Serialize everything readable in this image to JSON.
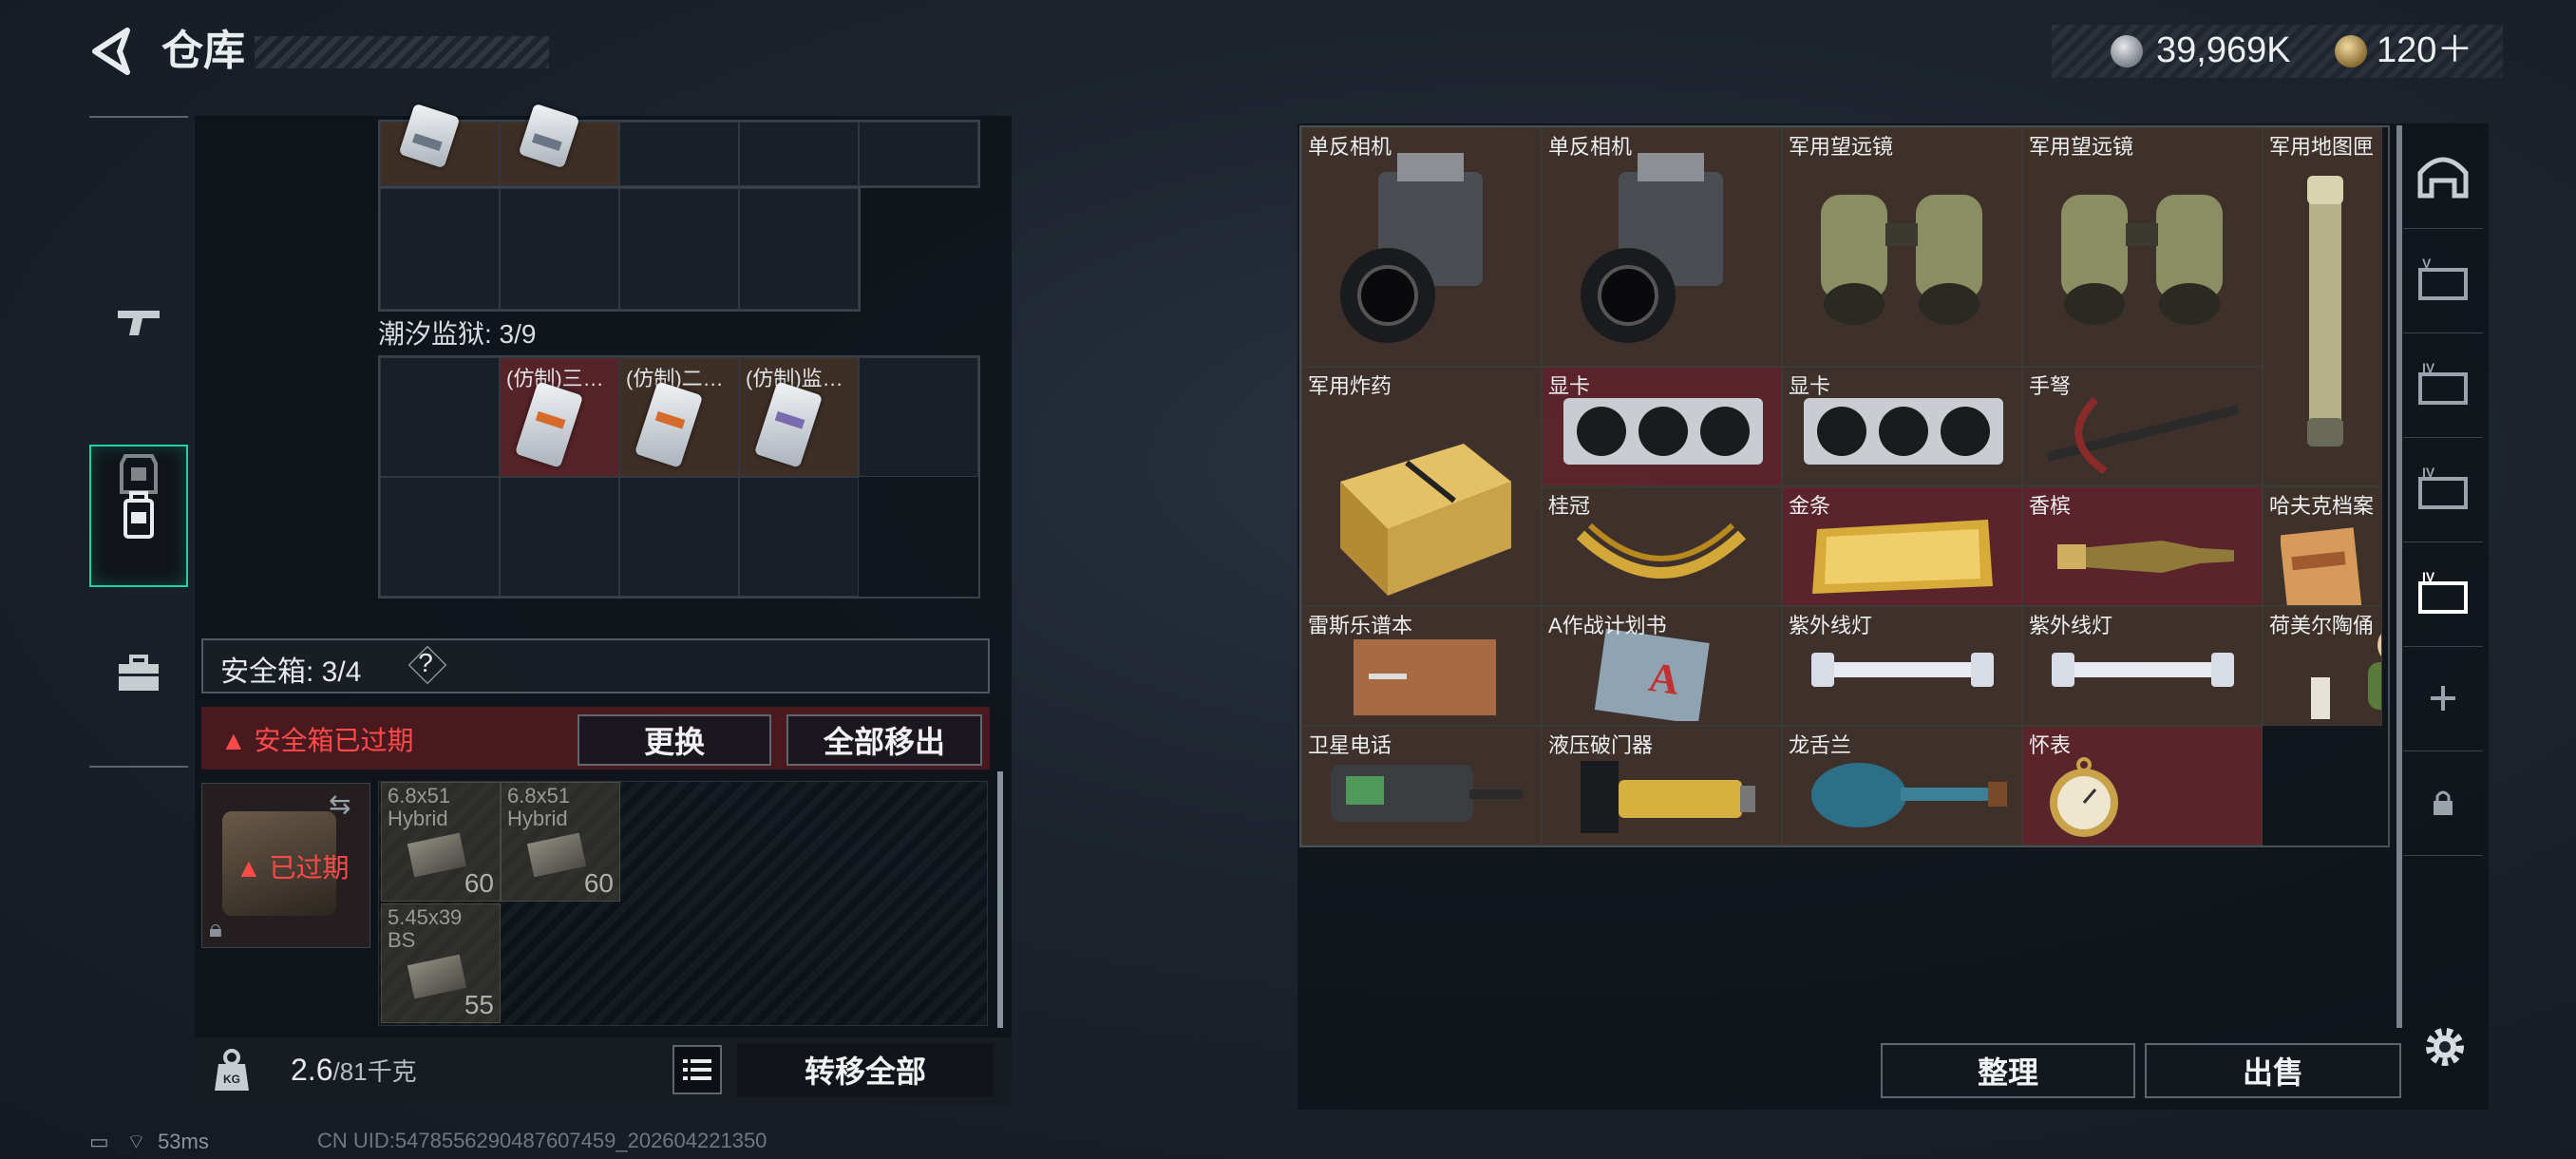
{
  "header": {
    "title": "仓库",
    "money": "39,969K",
    "tickets": "120＋"
  },
  "side_tabs": [
    {
      "name": "weapons-tab-icon"
    },
    {
      "name": "gear-tab-icon"
    },
    {
      "name": "backpack-tab-icon"
    },
    {
      "name": "case-tab-icon"
    }
  ],
  "left": {
    "prison_label": "潮汐监狱: 3/9",
    "prison_items": [
      "(仿制)三…",
      "(仿制)二…",
      "(仿制)监…"
    ],
    "safebox_label": "安全箱: 3/4",
    "safebox_help": "?",
    "expired_warning": "▲ 安全箱已过期",
    "replace_label": "更换",
    "move_all_label": "全部移出",
    "expired_tag": "已过期",
    "ammo": [
      {
        "name": "6.8x51 Hybrid",
        "qty": "60"
      },
      {
        "name": "6.8x51 Hybrid",
        "qty": "60"
      },
      {
        "name": "5.45x39 BS",
        "qty": "55"
      }
    ],
    "weight_value": "2.6",
    "weight_capacity": "/81千克",
    "transfer_all_label": "转移全部"
  },
  "status": {
    "ping": "53ms",
    "uid": "CN UID:5478556290487607459_202604221350"
  },
  "stash": {
    "items": [
      {
        "label": "单反相机",
        "span": 1,
        "rows": 1,
        "color": "brown"
      },
      {
        "label": "单反相机",
        "span": 1,
        "rows": 1,
        "color": "brown"
      },
      {
        "label": "军用望远镜",
        "span": 1,
        "rows": 1,
        "color": "brown"
      },
      {
        "label": "军用望远镜",
        "span": 1,
        "rows": 1,
        "color": "brown"
      },
      {
        "label": "军用地图匣",
        "span": 1,
        "rows": 2,
        "color": "brown"
      },
      {
        "label": "军用炸药",
        "span": 1,
        "rows": 2,
        "color": "brown"
      },
      {
        "label": "显卡",
        "span": 1,
        "rows": 1,
        "color": "red"
      },
      {
        "label": "显卡",
        "span": 1,
        "rows": 1,
        "color": "brown"
      },
      {
        "label": "手弩",
        "span": 1,
        "rows": 1,
        "color": "brown"
      },
      {
        "label": "桂冠",
        "span": 1,
        "rows": 1,
        "color": "brown"
      },
      {
        "label": "金条",
        "span": 1,
        "rows": 1,
        "color": "red"
      },
      {
        "label": "香槟",
        "span": 1,
        "rows": 1,
        "color": "red"
      },
      {
        "label": "哈夫克档案",
        "span": 1,
        "rows": 2,
        "color": "red"
      },
      {
        "label": "雷斯乐谱本",
        "span": 1,
        "rows": 1,
        "color": "brown"
      },
      {
        "label": "A作战计划书",
        "span": 1,
        "rows": 1,
        "color": "brown"
      },
      {
        "label": "紫外线灯",
        "span": 1,
        "rows": 1,
        "color": "brown"
      },
      {
        "label": "紫外线灯",
        "span": 1,
        "rows": 1,
        "color": "brown"
      },
      {
        "label": "荷美尔陶俑",
        "span": 1,
        "rows": 1,
        "color": "brown"
      },
      {
        "label": "卫星电话",
        "span": 1,
        "rows": 1,
        "color": "brown"
      },
      {
        "label": "液压破门器",
        "span": 1,
        "rows": 1,
        "color": "brown"
      },
      {
        "label": "龙舌兰",
        "span": 1,
        "rows": 1,
        "color": "brown"
      },
      {
        "label": "怀表",
        "span": 1,
        "rows": 1,
        "color": "red"
      }
    ],
    "sort_label": "整理",
    "sell_label": "出售"
  },
  "tools": [
    {
      "name": "safehouse-icon",
      "roman": ""
    },
    {
      "name": "case-v-icon",
      "roman": "V"
    },
    {
      "name": "case-iv-icon",
      "roman": "IV"
    },
    {
      "name": "case-iv-icon",
      "roman": "IV"
    },
    {
      "name": "case-iv-selected-icon",
      "roman": "IV"
    },
    {
      "name": "add-icon",
      "roman": ""
    },
    {
      "name": "lock-icon",
      "roman": ""
    }
  ],
  "colors": {
    "accent": "#1fd1a1",
    "warning": "#ff4a4a",
    "item_brown": "#4a382e",
    "item_red": "#6e2830"
  }
}
